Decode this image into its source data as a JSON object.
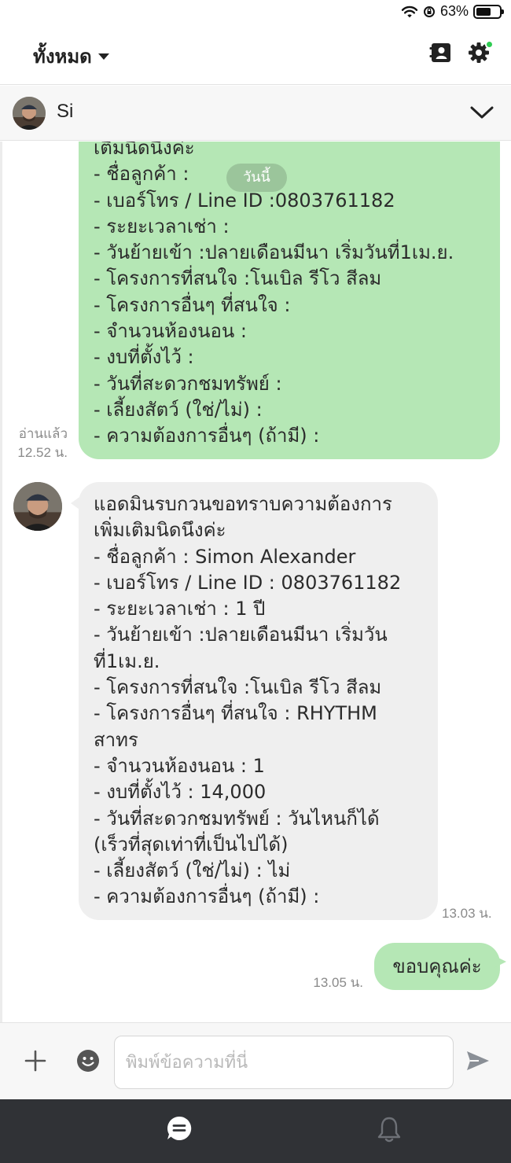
{
  "status_bar": {
    "battery": "63%",
    "battery_level": 0.63
  },
  "header": {
    "filter_label": "ทั้งหมด"
  },
  "chat": {
    "name": "Si"
  },
  "date_separator": "วันนี้",
  "messages": [
    {
      "direction": "out",
      "text": "เติมนิดนึงค่ะ\n- ชื่อลูกค้า :\n- เบอร์โทร / Line ID :0803761182\n- ระยะเวลาเช่า :\n- วันย้ายเข้า :ปลายเดือนมีนา เริ่มวันที่1เม.ย.\n- โครงการที่สนใจ :โนเบิล รีโว สีลม\n- โครงการอื่นๆ ที่สนใจ :\n- จำนวนห้องนอน :\n- งบที่ตั้งไว้ :\n- วันที่สะดวกชมทรัพย์ :\n- เลี้ยงสัตว์ (ใช่/ไม่) :\n- ความต้องการอื่นๆ (ถ้ามี) :",
      "read_label": "อ่านแล้ว",
      "time": "12.52 น."
    },
    {
      "direction": "in",
      "text": "แอดมินรบกวนขอทราบความต้องการ\nเพิ่มเติมนิดนึงค่ะ\n- ชื่อลูกค้า : Simon Alexander\n- เบอร์โทร / Line ID : 0803761182\n- ระยะเวลาเช่า : 1 ปี\n- วันย้ายเข้า :ปลายเดือนมีนา เริ่มวัน\nที่1เม.ย.\n- โครงการที่สนใจ :โนเบิล รีโว สีลม\n- โครงการอื่นๆ ที่สนใจ : RHYTHM\nสาทร\n- จำนวนห้องนอน : 1\n- งบที่ตั้งไว้ : 14,000\n- วันที่สะดวกชมทรัพย์ : วันไหนก็ได้\n(เร็วที่สุดเท่าที่เป็นไปได้)\n- เลี้ยงสัตว์ (ใช่/ไม่) : ไม่\n- ความต้องการอื่นๆ (ถ้ามี) :",
      "time": "13.03 น."
    },
    {
      "direction": "out",
      "text": "ขอบคุณค่ะ",
      "time": "13.05 น."
    }
  ],
  "composer": {
    "placeholder": "พิมพ์ข้อความที่นี่"
  },
  "icons": {
    "wifi": "wifi-icon",
    "rotation_lock": "rotation-lock-icon",
    "battery": "battery-icon",
    "contacts": "contact-card-icon",
    "settings": "gear-icon",
    "chevron": "chevron-down-icon",
    "add": "plus-icon",
    "emoji": "emoji-icon",
    "send": "send-icon",
    "chat_tab": "chat-bubble-icon",
    "notifications_tab": "bell-icon"
  },
  "colors": {
    "outgoing_bubble": "#b5e7b5",
    "incoming_bubble": "#efefef",
    "nav_background": "#303236",
    "online_dot": "#2ecc52"
  }
}
